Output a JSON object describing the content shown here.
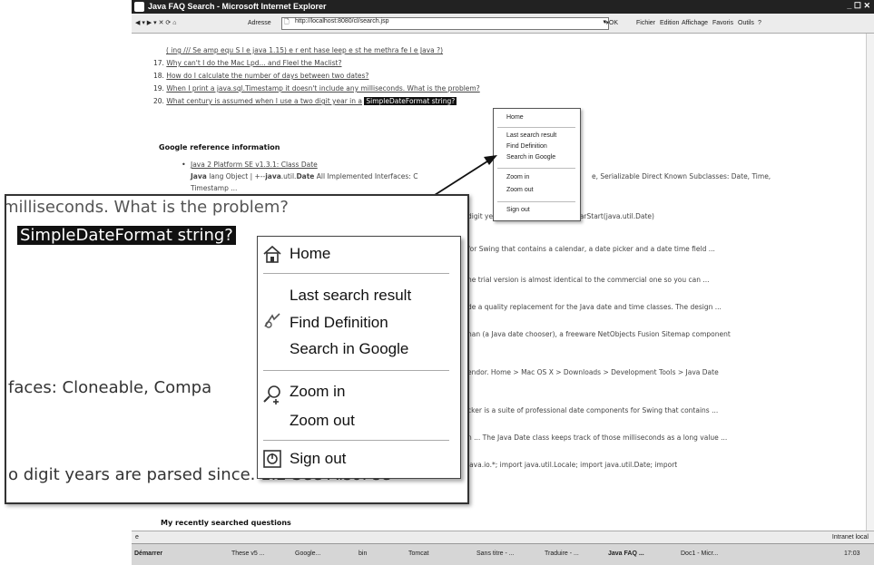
{
  "window": {
    "title": "Java FAQ Search - Microsoft Internet Explorer",
    "controls": "_ ☐ ✕"
  },
  "toolbar": {
    "address_label": "Adresse",
    "address_value": "http://localhost:8080/cl/search.jsp",
    "ok_label": "OK",
    "menus": [
      "Fichier",
      "Edition",
      "Affichage",
      "Favoris",
      "Outils",
      "?"
    ]
  },
  "questions": [
    {
      "num": "",
      "text": "( ing /// Se amp equ S   l e    java 1.15)  e   r   ent hase   leep e  st he methra   fe   l e   Java   ?)"
    },
    {
      "num": "17.",
      "text": "Why can't I do   the Mac  Lpd... and Fleel the Maclist?"
    },
    {
      "num": "18.",
      "text": "How do I calculate the number of days between two dates?"
    },
    {
      "num": "19.",
      "text": "When I print a java.sql.Timestamp it doesn't include any milliseconds. What is the problem?"
    },
    {
      "num": "20.",
      "text": "What century is assumed when I use a two digit year in a",
      "highlight": "SimpleDateFormat string?"
    }
  ],
  "google": {
    "heading": "Google reference information",
    "link": "Java 2 Platform SE v1.3.1: Class Date",
    "desc1_a": "Java",
    "desc1_b": " lang Object | +--",
    "desc1_c": "java",
    "desc1_d": ".util.",
    "desc1_e": "Date",
    "desc1_f": " All Implemented Interfaces: C",
    "desc1_right": "e, Serializable Direct Known Subclasses: Date, Time,",
    "desc2": "Timestamp ...",
    "lines": [
      "digit ye                    1.2 See Also:  set2DigitYearStart(java.util.Date)",
      "for Swing that contains a calendar, a date picker and a date time field ...",
      "he trial version is almost identical to the commercial one so you can ...",
      "de a quality replacement for the Java date and time classes. The design ...",
      "nan (a Java date chooser), a freeware NetObjects Fusion Sitemap component",
      "endor. Home > Mac OS X > Downloads > Development Tools > Java Date",
      "cker is a suite of professional date components for Swing that contains ...",
      "n ... The Java Date class keeps track of those milliseconds as a long value ...",
      "java.io.*; import java.util.Locale; import java.util.Date; import"
    ]
  },
  "recent_heading": "My recently searched questions",
  "small_menu": {
    "items": [
      "Home",
      "Last search result",
      "Find Definition",
      "Search in Google",
      "Zoom in",
      "Zoom out",
      "Sign out"
    ]
  },
  "zoom": {
    "line1": "milliseconds. What is the problem?",
    "selection": "SimpleDateFormat string?",
    "line_faces": "faces: Cloneable, Compa",
    "line_digit": "o digit years are parsed since. 1.2 See Also: se",
    "menu": {
      "home": "Home",
      "last_search": "Last search result",
      "find_definition": "Find Definition",
      "search_google": "Search in Google",
      "zoom_in": "Zoom in",
      "zoom_out": "Zoom out",
      "sign_out": "Sign out"
    }
  },
  "status": {
    "zone": "Intranet local"
  },
  "taskbar": {
    "start": "Démarrer",
    "items": [
      "These v5 ...",
      "Google...",
      "bin",
      "Tomcat",
      "Sans titre - ...",
      "Traduire - ...",
      "Java FAQ ...",
      "Doc1 - Micr..."
    ],
    "clock": "17:03"
  }
}
